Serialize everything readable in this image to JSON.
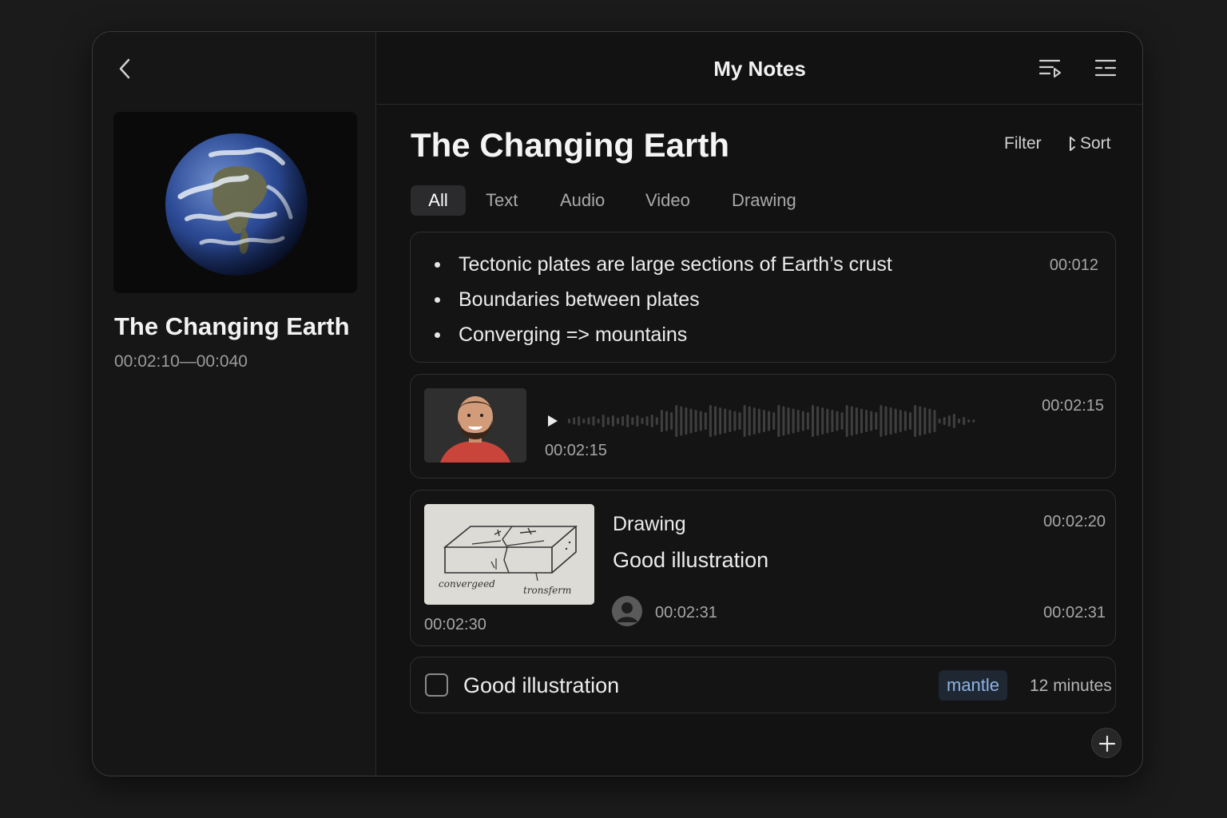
{
  "header": {
    "title": "My Notes"
  },
  "sidebar": {
    "lecture_title": "The Changing Earth",
    "time_range": "00:02:10—00:040"
  },
  "main": {
    "title": "The Changing Earth",
    "filter_label": "Filter",
    "sort_label": "Sort",
    "tabs": [
      {
        "label": "All",
        "active": true
      },
      {
        "label": "Text",
        "active": false
      },
      {
        "label": "Audio",
        "active": false
      },
      {
        "label": "Video",
        "active": false
      },
      {
        "label": "Drawing",
        "active": false
      }
    ]
  },
  "notes": {
    "text_note": {
      "bullets": [
        "Tectonic plates are large sections of Earth’s crust",
        "Boundaries between plates",
        "Converging => mountains"
      ],
      "timestamp": "00:012"
    },
    "audio_note": {
      "timestamp": "00:02:15",
      "duration": "00:02:15"
    },
    "drawing_note": {
      "label": "Drawing",
      "note": "Good illustration",
      "thumb_timestamp": "00:02:30",
      "timestamp": "00:02:20",
      "author_timestamp": "00:02:31",
      "end_timestamp": "00:02:31",
      "sketch_labels": [
        "convergeed",
        "tronsferm"
      ]
    },
    "task_note": {
      "text": "Good illustration",
      "tag": "mantle",
      "time": "12 minutes",
      "checked": false
    }
  },
  "colors": {
    "background": "#1b1b1b",
    "panel": "#121212",
    "card_border": "#2f2f2f",
    "tag_bg": "#1f2733",
    "tag_text": "#8fb3e3"
  },
  "icons": [
    "back-chevron-icon",
    "playlist-icon",
    "list-settings-icon",
    "sort-icon",
    "play-icon",
    "user-icon",
    "plus-icon"
  ]
}
